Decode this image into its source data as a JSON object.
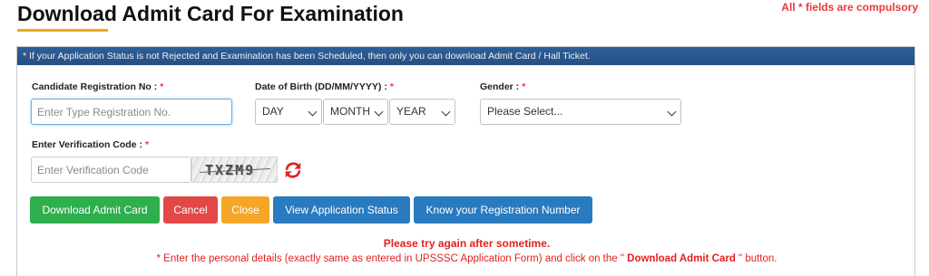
{
  "header": {
    "title": "Download Admit Card For Examination",
    "compulsory_note": "All * fields are compulsory"
  },
  "banner": {
    "text": "* If your Application Status is not Rejected and Examination has been Scheduled, then only you can download Admit Card / Hall Ticket."
  },
  "form": {
    "required_mark": "*",
    "registration": {
      "label": "Candidate Registration No :",
      "placeholder": "Enter Type Registration No."
    },
    "dob": {
      "label": "Date of Birth (DD/MM/YYYY) :",
      "day": "DAY",
      "month": "MONTH",
      "year": "YEAR"
    },
    "gender": {
      "label": "Gender :",
      "selected": "Please Select..."
    },
    "verification": {
      "label": "Enter Verification Code :",
      "placeholder": "Enter Verification Code",
      "captcha_text": "TXZM9"
    }
  },
  "buttons": {
    "download": "Download Admit Card",
    "cancel": "Cancel",
    "close": "Close",
    "view_status": "View Application Status",
    "know_registration": "Know your Registration Number"
  },
  "messages": {
    "error": "Please try again after sometime.",
    "note_prefix": "* Enter the personal details (exactly same as entered in UPSSSC Application Form) and click on the \"",
    "note_bold": "Download Admit Card",
    "note_suffix": "\" button."
  },
  "colors": {
    "accent_underline": "#f2a71b",
    "banner": "#2e5f98",
    "success": "#2fae4e",
    "danger": "#e34848",
    "warning": "#f5a626",
    "primary": "#2a7abf",
    "error_text": "#e32020"
  },
  "icons": {
    "refresh": "refresh-icon"
  }
}
